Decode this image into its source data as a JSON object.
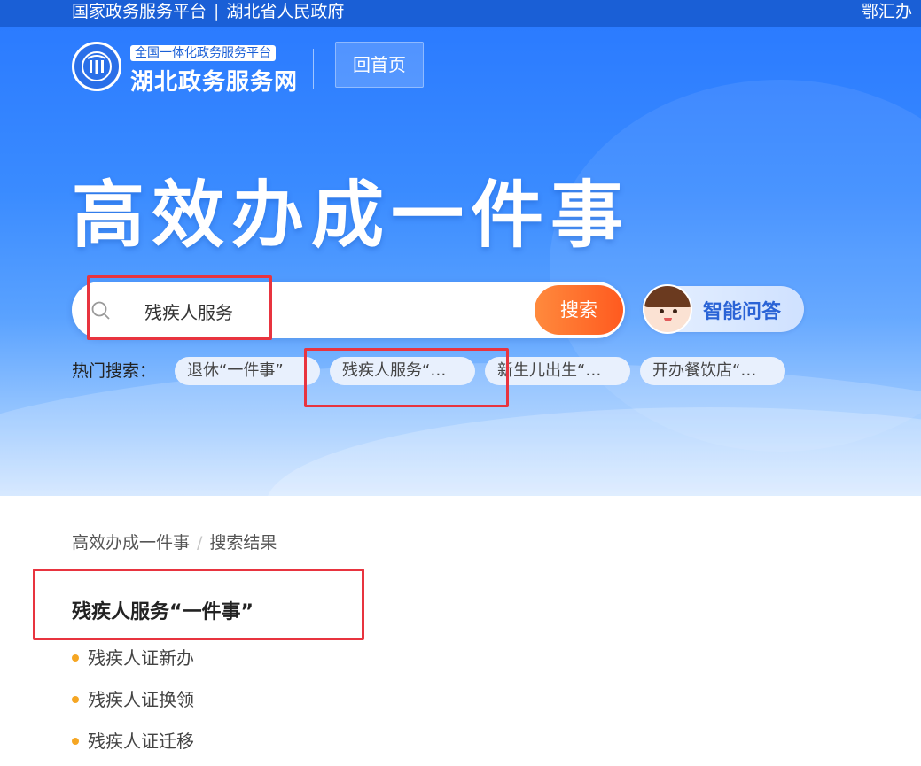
{
  "topbar": {
    "national_platform": "国家政务服务平台",
    "separator": "|",
    "province_gov": "湖北省人民政府",
    "right_link": "鄂汇办"
  },
  "header": {
    "logo_badge": "全国一体化政务服务平台",
    "logo_name": "湖北政务服务网",
    "home_button": "回首页"
  },
  "hero": {
    "headline": "高效办成一件事"
  },
  "search": {
    "value": "残疾人服务",
    "button": "搜索"
  },
  "assistant": {
    "label": "智能问答"
  },
  "hot_search": {
    "label": "热门搜索：",
    "chips": [
      "退休“一件事”",
      "残疾人服务“…",
      "新生儿出生“…",
      "开办餐饮店“…"
    ]
  },
  "breadcrumb": {
    "root": "高效办成一件事",
    "separator": "/",
    "current": "搜索结果"
  },
  "result": {
    "title": "残疾人服务“一件事”",
    "items": [
      "残疾人证新办",
      "残疾人证换领",
      "残疾人证迁移"
    ]
  },
  "colors": {
    "brand_blue": "#1a5fd6",
    "search_button": "#ff5a1f",
    "bullet": "#f5a623",
    "highlight_box": "#e8343f"
  }
}
